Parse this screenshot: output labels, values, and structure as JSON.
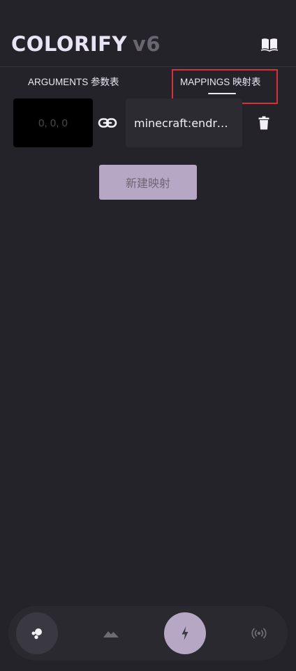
{
  "header": {
    "brand_name": "COLORIFY",
    "brand_version": "v6",
    "docs_icon": "open-book-icon"
  },
  "tabs": [
    {
      "label": "ARGUMENTS 参数表",
      "active": false
    },
    {
      "label": "MAPPINGS 映射表",
      "active": true
    }
  ],
  "mappings": [
    {
      "color": "#000000",
      "color_value": "0, 0, 0",
      "link_icon": "link-icon",
      "block": "minecraft:endro…",
      "delete_icon": "trash-icon"
    }
  ],
  "new_mapping_label": "新建映射",
  "bottom_nav": [
    {
      "icon": "bubbles-icon",
      "active": false
    },
    {
      "icon": "terrain-icon",
      "active": false
    },
    {
      "icon": "bolt-icon",
      "active": true
    },
    {
      "icon": "broadcast-icon",
      "active": false
    }
  ],
  "colors": {
    "background": "#25232a",
    "accent": "#b6a8c4",
    "highlight": "#dc2f3c"
  }
}
